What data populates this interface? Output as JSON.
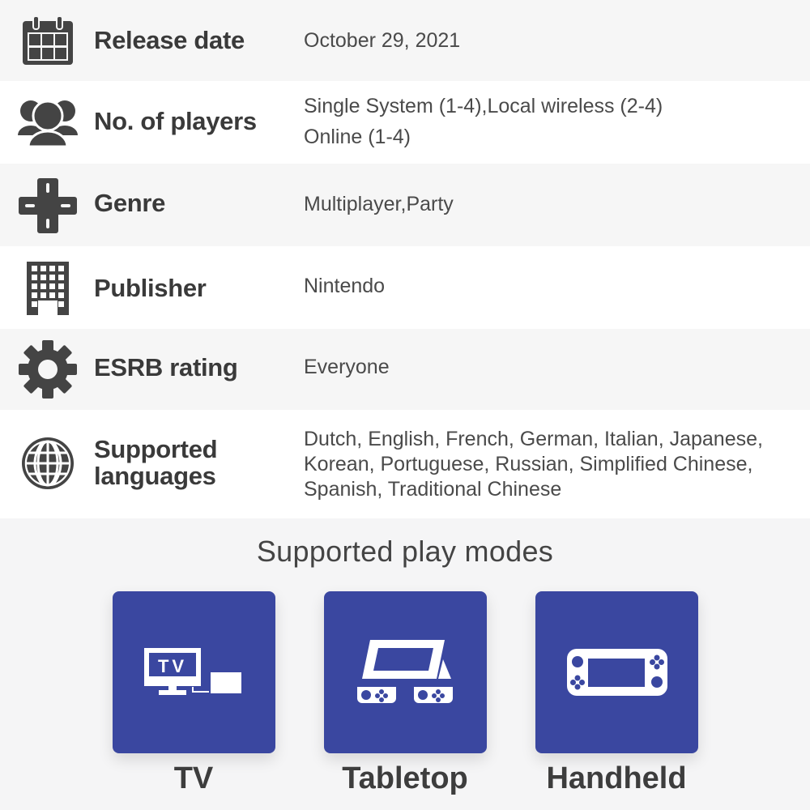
{
  "specs": [
    {
      "icon": "calendar-icon",
      "label": "Release date",
      "value_lines": [
        "October 29, 2021"
      ]
    },
    {
      "icon": "players-icon",
      "label": "No. of players",
      "value_lines": [
        "Single System (1-4),Local wireless (2-4)",
        "Online (1-4)"
      ]
    },
    {
      "icon": "dpad-icon",
      "label": "Genre",
      "value_lines": [
        "Multiplayer,Party"
      ]
    },
    {
      "icon": "building-icon",
      "label": "Publisher",
      "value_lines": [
        "Nintendo"
      ]
    },
    {
      "icon": "gear-icon",
      "label": "ESRB rating",
      "value_lines": [
        "Everyone"
      ]
    },
    {
      "icon": "globe-icon",
      "label_lines": [
        "Supported",
        "languages"
      ],
      "value_lines": [
        "Dutch, English, French, German, Italian, Japanese,",
        "Korean, Portuguese, Russian, Simplified Chinese,",
        "Spanish, Traditional Chinese"
      ]
    }
  ],
  "play_modes": {
    "title": "Supported play modes",
    "accent_color": "#3a47a0",
    "modes": [
      {
        "icon": "tv-mode-icon",
        "label": "TV",
        "icon_text": "TV"
      },
      {
        "icon": "tabletop-mode-icon",
        "label": "Tabletop"
      },
      {
        "icon": "handheld-mode-icon",
        "label": "Handheld"
      }
    ]
  }
}
